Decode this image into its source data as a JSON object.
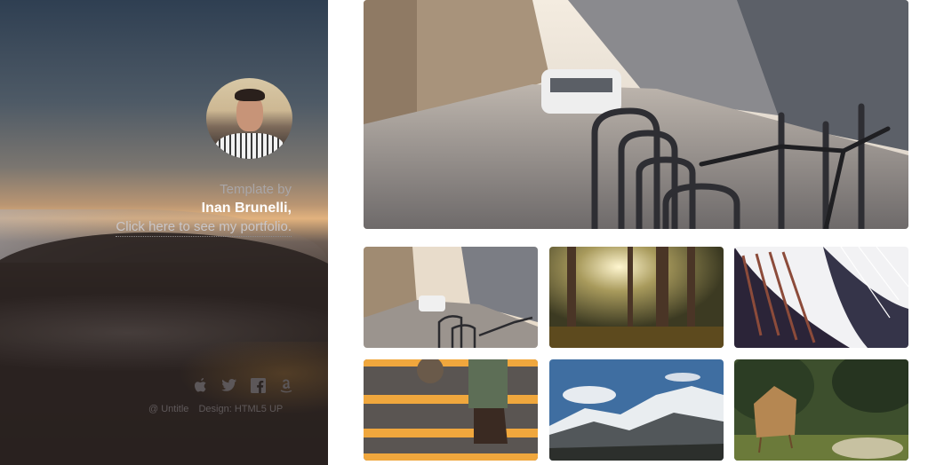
{
  "sidebar": {
    "template_by": "Template by",
    "author": "Inan Brunelli,",
    "portfolio_link": "Click here to see my portfolio.",
    "social": [
      {
        "icon": "apple-icon",
        "glyph": ""
      },
      {
        "icon": "twitter-icon",
        "glyph": "t"
      },
      {
        "icon": "facebook-icon",
        "glyph": "f"
      },
      {
        "icon": "amazon-icon",
        "glyph": "a"
      }
    ],
    "credits": [
      "@ Untitle",
      "Design: HTML5 UP"
    ]
  },
  "gallery": {
    "hero_alt": "City street with bicycle racks",
    "thumbs": [
      {
        "alt": "City street with bicycles"
      },
      {
        "alt": "Sunlit forest"
      },
      {
        "alt": "Curved library bookshelves"
      },
      {
        "alt": "Stairs with boots"
      },
      {
        "alt": "Snowy mountain range"
      },
      {
        "alt": "Wooden hut in forest"
      }
    ]
  }
}
